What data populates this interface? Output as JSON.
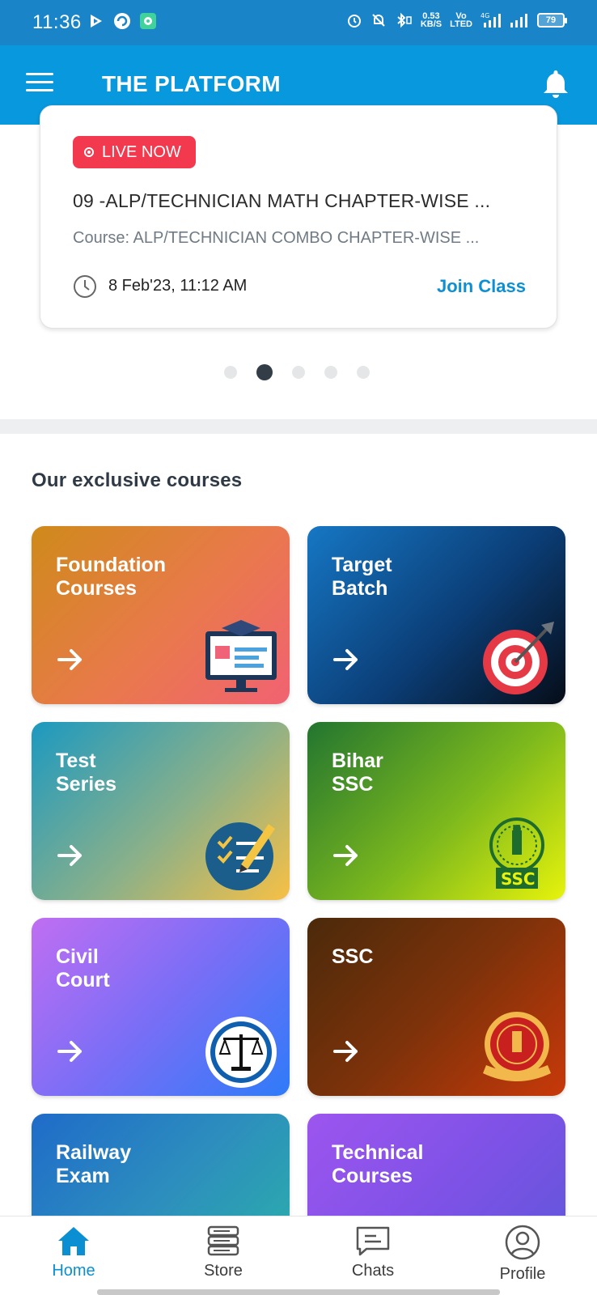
{
  "status_bar": {
    "time": "11:36",
    "net_speed_value": "0.53",
    "net_speed_unit": "KB/S",
    "volte_top": "Vo",
    "volte_bottom": "LTED",
    "network": "4G",
    "battery": "79"
  },
  "app_bar": {
    "title": "THE PLATFORM",
    "menu_icon": "hamburger-menu-icon",
    "bell_icon": "bell-icon"
  },
  "live_class": {
    "badge": "LIVE NOW",
    "title": "09 -ALP/TECHNICIAN MATH CHAPTER-WISE ...",
    "course": "Course: ALP/TECHNICIAN COMBO CHAPTER-WISE ...",
    "time": "8 Feb'23, 11:12 AM",
    "join_label": "Join Class",
    "accent": "#f2394e"
  },
  "carousel": {
    "total": 5,
    "active_index": 1
  },
  "courses_section": {
    "title": "Our exclusive courses",
    "items": [
      {
        "label": "Foundation\nCourses",
        "icon": "monitor-graduation-icon"
      },
      {
        "label": "Target\nBatch",
        "icon": "target-dart-icon"
      },
      {
        "label": "Test\nSeries",
        "icon": "checklist-pencil-icon"
      },
      {
        "label": "Bihar\nSSC",
        "icon": "ssc-emblem-icon"
      },
      {
        "label": "Civil\nCourt",
        "icon": "scales-of-justice-icon"
      },
      {
        "label": "SSC",
        "icon": "ssc-seal-icon"
      },
      {
        "label": "Railway\nExam",
        "icon": "indian-railway-logo-icon"
      },
      {
        "label": "Technical\nCourses",
        "icon": "books-icon"
      }
    ]
  },
  "bottom_nav": {
    "items": [
      {
        "label": "Home",
        "icon": "home-icon",
        "active": true
      },
      {
        "label": "Store",
        "icon": "store-books-icon",
        "active": false
      },
      {
        "label": "Chats",
        "icon": "chat-icon",
        "active": false
      },
      {
        "label": "Profile",
        "icon": "profile-icon",
        "active": false
      }
    ],
    "active_color": "#0b8fd3"
  }
}
